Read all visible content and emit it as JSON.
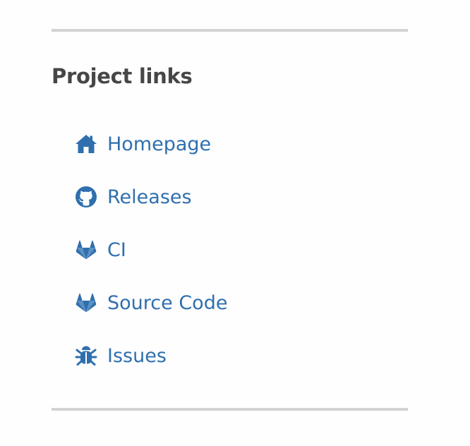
{
  "section": {
    "title": "Project links",
    "links": [
      {
        "label": "Homepage",
        "icon": "home-icon"
      },
      {
        "label": "Releases",
        "icon": "github-icon"
      },
      {
        "label": "CI",
        "icon": "gitlab-icon"
      },
      {
        "label": "Source Code",
        "icon": "gitlab-icon"
      },
      {
        "label": "Issues",
        "icon": "bug-icon"
      }
    ]
  },
  "colors": {
    "link": "#2f6fae",
    "heading": "#464646",
    "divider": "#d3d3d3"
  }
}
